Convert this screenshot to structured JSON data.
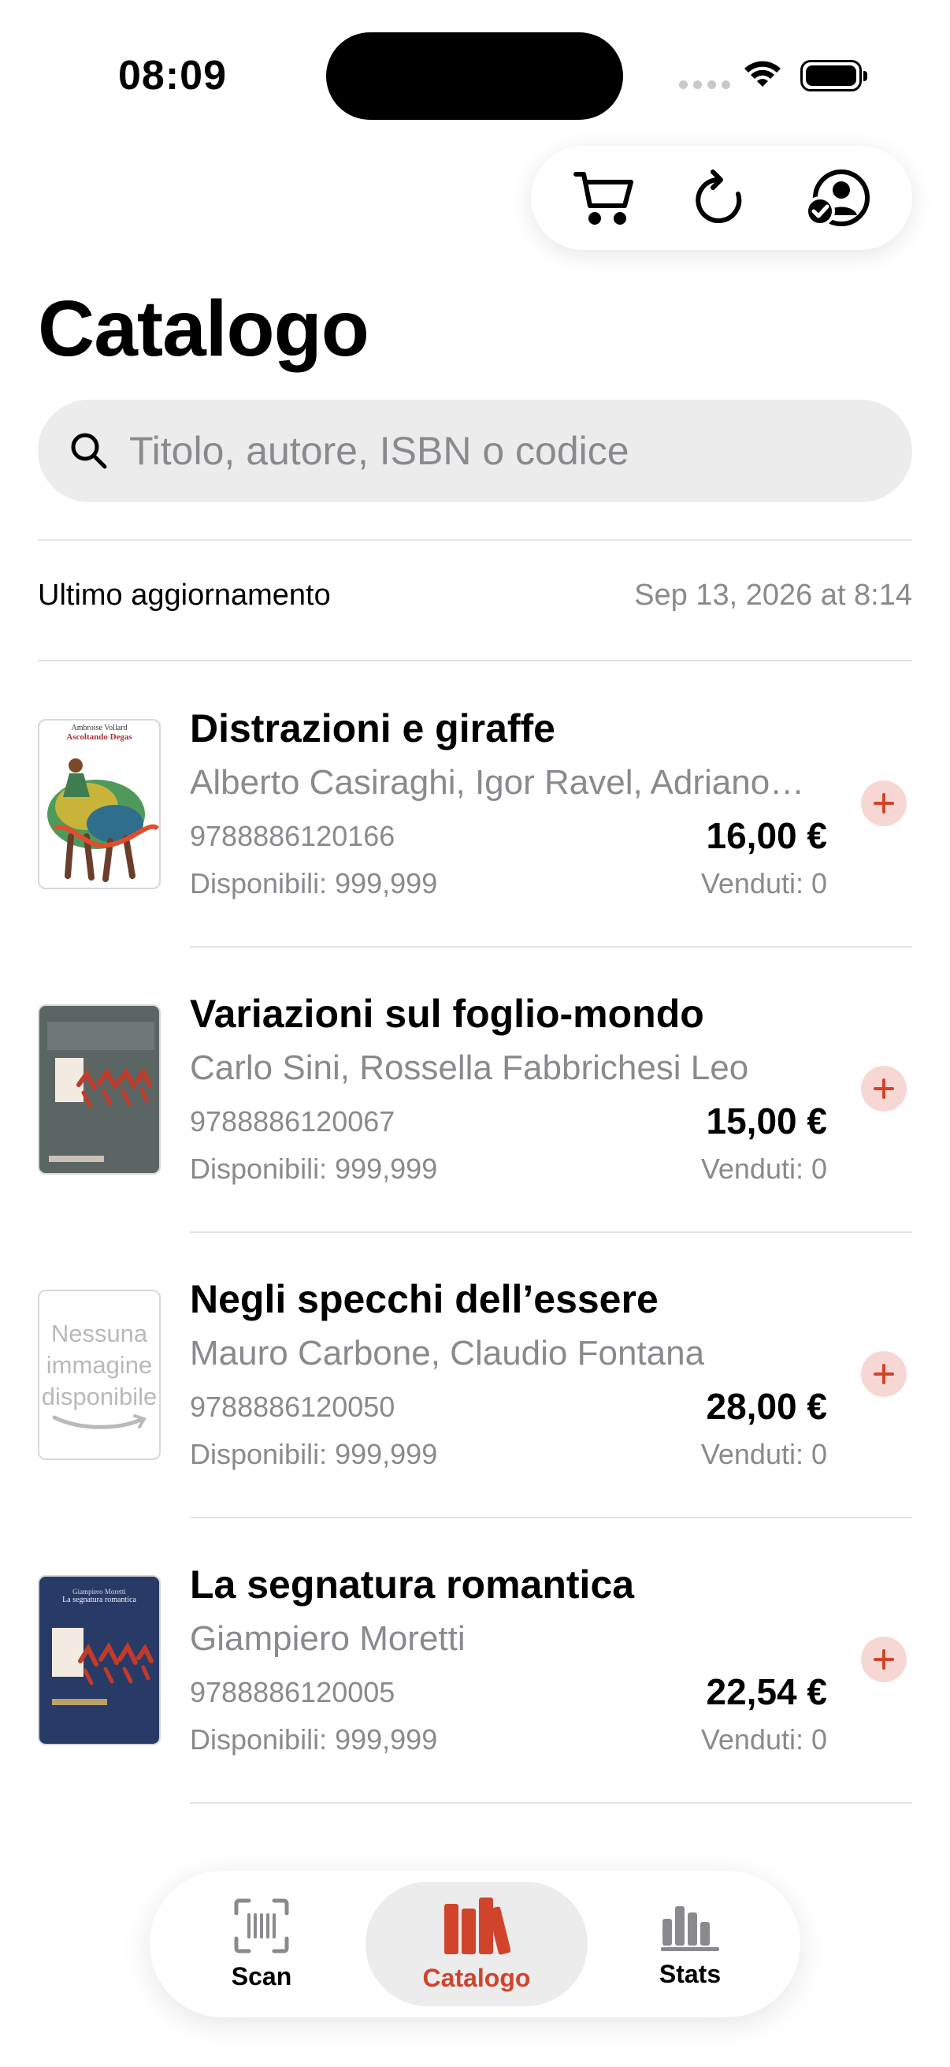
{
  "status_bar": {
    "time": "08:09"
  },
  "page": {
    "title": "Catalogo"
  },
  "search": {
    "placeholder": "Titolo, autore, ISBN o codice"
  },
  "last_update": {
    "label": "Ultimo aggiornamento",
    "value": "Sep 13, 2026 at 8:14"
  },
  "books": [
    {
      "title": "Distrazioni e giraffe",
      "authors": "Alberto Casiraghi, Igor Ravel, Adriano…",
      "isbn": "9788886120166",
      "price": "16,00 €",
      "available": "Disponibili: 999,999",
      "sold": "Venduti: 0",
      "cover_text": [
        "Ambroise Vollard",
        "Ascoltando Degas"
      ]
    },
    {
      "title": "Variazioni sul foglio-mondo",
      "authors": "Carlo Sini, Rossella Fabbrichesi Leo",
      "isbn": "9788886120067",
      "price": "15,00 €",
      "available": "Disponibili: 999,999",
      "sold": "Venduti: 0"
    },
    {
      "title": "Negli specchi dell’essere",
      "authors": "Mauro Carbone, Claudio Fontana",
      "isbn": "9788886120050",
      "price": "28,00 €",
      "available": "Disponibili: 999,999",
      "sold": "Venduti: 0",
      "cover_placeholder": [
        "Nessuna",
        "immagine",
        "disponibile"
      ]
    },
    {
      "title": "La segnatura romantica",
      "authors": "Giampiero Moretti",
      "isbn": "9788886120005",
      "price": "22,54 €",
      "available": "Disponibili: 999,999",
      "sold": "Venduti: 0",
      "cover_text": [
        "Giampiero Moretti",
        "La segnatura romantica"
      ]
    }
  ],
  "tabbar": {
    "tabs": [
      {
        "label": "Scan",
        "icon": "barcode-scan-icon"
      },
      {
        "label": "Catalogo",
        "icon": "books-icon",
        "active": true
      },
      {
        "label": "Stats",
        "icon": "bar-chart-icon"
      }
    ]
  },
  "colors": {
    "accent": "#d0442c",
    "add_button_bg": "#f7d7d3",
    "secondary_text": "#8a8a8e"
  }
}
